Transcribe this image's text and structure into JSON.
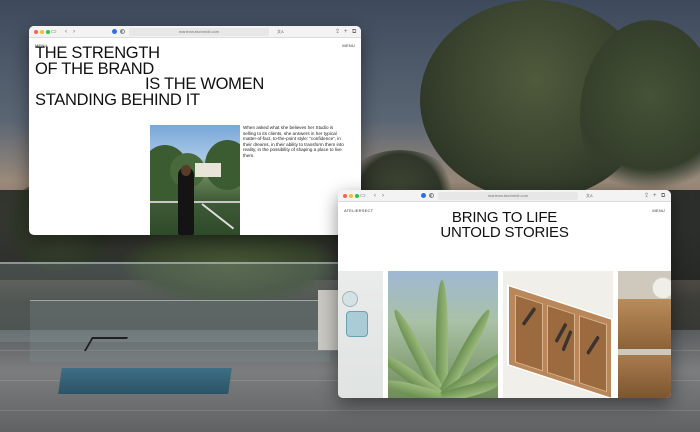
{
  "window_front_left": {
    "url": "marieneutschmidt.com",
    "nav_left": "MENU",
    "nav_right": "MENU",
    "headline": [
      "THE STRENGTH",
      "OF THE BRAND",
      "IS THE WOMEN",
      "STANDING BEHIND IT"
    ],
    "paragraph": "When asked what she believes her Studio is selling to its clients, she answers in her typical matter-of-fact, to-the-point style: “confidence”, in their dreams, in their ability to transform them into reality, in the possibility of shaping a place to live them."
  },
  "window_front_right": {
    "url": "marieneutschmidt.com",
    "nav_left": "ATELIERSECT",
    "nav_right": "MENU",
    "headline": [
      "BRING TO LIFE",
      "UNTOLD STORIES"
    ]
  },
  "colors": {
    "traffic_red": "#fe5f57",
    "traffic_yellow": "#febc2e",
    "traffic_green": "#28c840",
    "safari_shield": "#2f6cf0"
  },
  "icons": {
    "sidebar": "sidebar-icon",
    "back": "chevron-left-icon",
    "forward": "chevron-right-icon",
    "share": "share-icon",
    "new_tab": "plus-icon",
    "tabs": "tabs-overview-icon",
    "translate": "translate-icon"
  }
}
